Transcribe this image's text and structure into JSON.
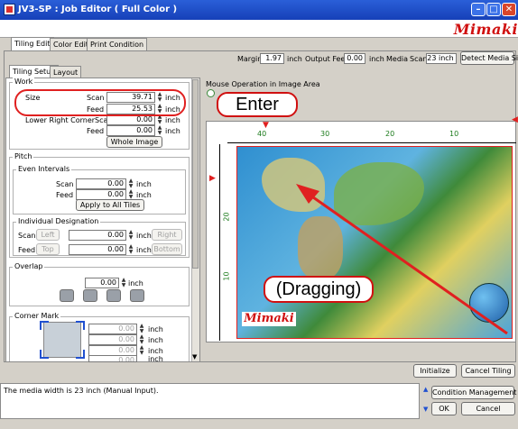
{
  "window": {
    "title": "JV3-SP : Job Editor ( Full Color )",
    "controls": [
      "–",
      "□",
      "✕"
    ]
  },
  "brand": "Mimaki",
  "main_tabs": [
    "Tiling Edit",
    "Color Edit",
    "Print Condition"
  ],
  "info_bar": {
    "margin_label": "Margin",
    "margin_value": "1.97",
    "unit": "inch",
    "output_feed_label": "Output Feed",
    "output_feed_value": "0.00",
    "media_label": "Media",
    "scan_label": "Scan",
    "scan_value": "23 inch",
    "detect_button": "Detect Media Size"
  },
  "sub_tabs": [
    "Tiling Setup",
    "Layout"
  ],
  "work": {
    "title": "Work",
    "size_label": "Size",
    "scan_label": "Scan",
    "scan_value": "39.71",
    "feed_label": "Feed",
    "feed_value": "25.53",
    "lower_right_label": "Lower Right CornerScan",
    "lower_scan_value": "0.00",
    "lower_feed_label": "Feed",
    "lower_feed_value": "0.00",
    "unit": "inch",
    "whole_image_button": "Whole Image"
  },
  "pitch": {
    "title": "Pitch",
    "even_title": "Even Intervals",
    "scan_label": "Scan",
    "scan_value": "0.00",
    "feed_label": "Feed",
    "feed_value": "0.00",
    "unit": "inch",
    "apply_button": "Apply to All Tiles",
    "individual_title": "Individual Designation",
    "ind_scan_label": "Scan",
    "left_button": "Left",
    "ind_scan_value": "0.00",
    "right_button": "Right",
    "ind_feed_label": "Feed",
    "top_button": "Top",
    "ind_feed_value": "0.00",
    "bottom_button": "Bottom"
  },
  "overlap": {
    "title": "Overlap",
    "value": "0.00",
    "unit": "inch"
  },
  "corner_mark": {
    "title": "Corner Mark",
    "values": [
      "0.00",
      "0.00",
      "0.00",
      "0.00"
    ],
    "unit": "inch"
  },
  "preview": {
    "header": "Mouse Operation in Image Area",
    "ruler_labels": [
      "40",
      "30",
      "20",
      "10"
    ],
    "side_ruler_labels": [
      "20",
      "10"
    ]
  },
  "callouts": {
    "enter": "Enter",
    "dragging": "(Dragging)"
  },
  "actions": {
    "initialize": "Initialize",
    "cancel_tiling": "Cancel Tiling"
  },
  "status": {
    "message": "The media width is 23 inch (Manual Input)."
  },
  "bottom_buttons": {
    "condition": "Condition Management",
    "ok": "OK",
    "cancel": "Cancel"
  },
  "colors": {
    "title_bar": "#2a5fd8",
    "accent_red": "#d01010",
    "panel_bg": "#d4d0c8"
  }
}
